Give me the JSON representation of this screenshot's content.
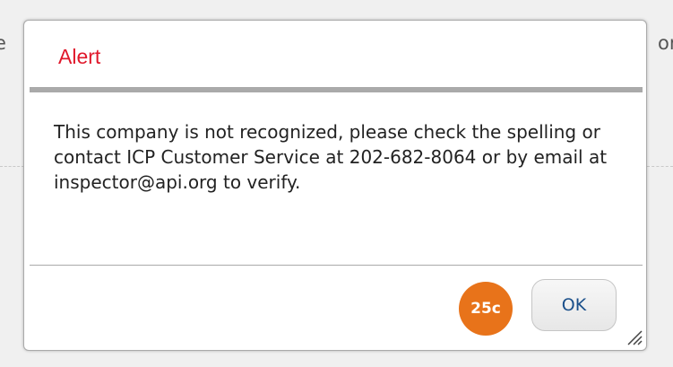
{
  "background": {
    "left_fragment": "e",
    "right_fragment": "or"
  },
  "dialog": {
    "title": "Alert",
    "message": "This company is not recognized, please check the spelling or contact ICP Customer Service at 202-682-8064 or by email at inspector@api.org to verify.",
    "badge_text": "25c",
    "ok_label": "OK",
    "colors": {
      "title": "#e0182b",
      "badge": "#e8731a",
      "button_text": "#1a4f8a"
    },
    "resize_icon": "resize-grip-icon"
  }
}
